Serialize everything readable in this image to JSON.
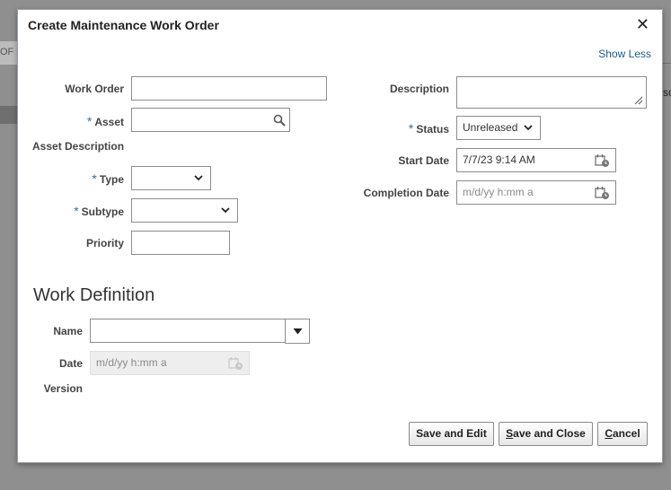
{
  "background": {
    "fragment_left": "OF",
    "fragment_right": "sc"
  },
  "dialog": {
    "title": "Create Maintenance Work Order",
    "close_glyph": "✕",
    "show_less": "Show Less",
    "fields": {
      "work_order": {
        "label": "Work Order",
        "value": ""
      },
      "asset": {
        "label": "Asset",
        "value": "",
        "required": "*"
      },
      "asset_description": {
        "label": "Asset Description"
      },
      "type": {
        "label": "Type",
        "value": "",
        "required": "*"
      },
      "subtype": {
        "label": "Subtype",
        "value": "",
        "required": "*"
      },
      "priority": {
        "label": "Priority",
        "value": ""
      },
      "description": {
        "label": "Description",
        "value": ""
      },
      "status": {
        "label": "Status",
        "value": "Unreleased",
        "required": "*"
      },
      "start_date": {
        "label": "Start Date",
        "value": "7/7/23 9:14 AM"
      },
      "completion_date": {
        "label": "Completion Date",
        "placeholder": "m/d/yy h:mm a"
      }
    },
    "work_definition": {
      "title": "Work Definition",
      "name": {
        "label": "Name",
        "value": ""
      },
      "date": {
        "label": "Date",
        "placeholder": "m/d/yy h:mm a"
      },
      "version": {
        "label": "Version"
      }
    },
    "buttons": {
      "save_and_edit": "Save and Edit",
      "save_and_close_mnemonic": "S",
      "save_and_close_rest": "ave and Close",
      "cancel_mnemonic": "C",
      "cancel_rest": "ancel"
    }
  }
}
